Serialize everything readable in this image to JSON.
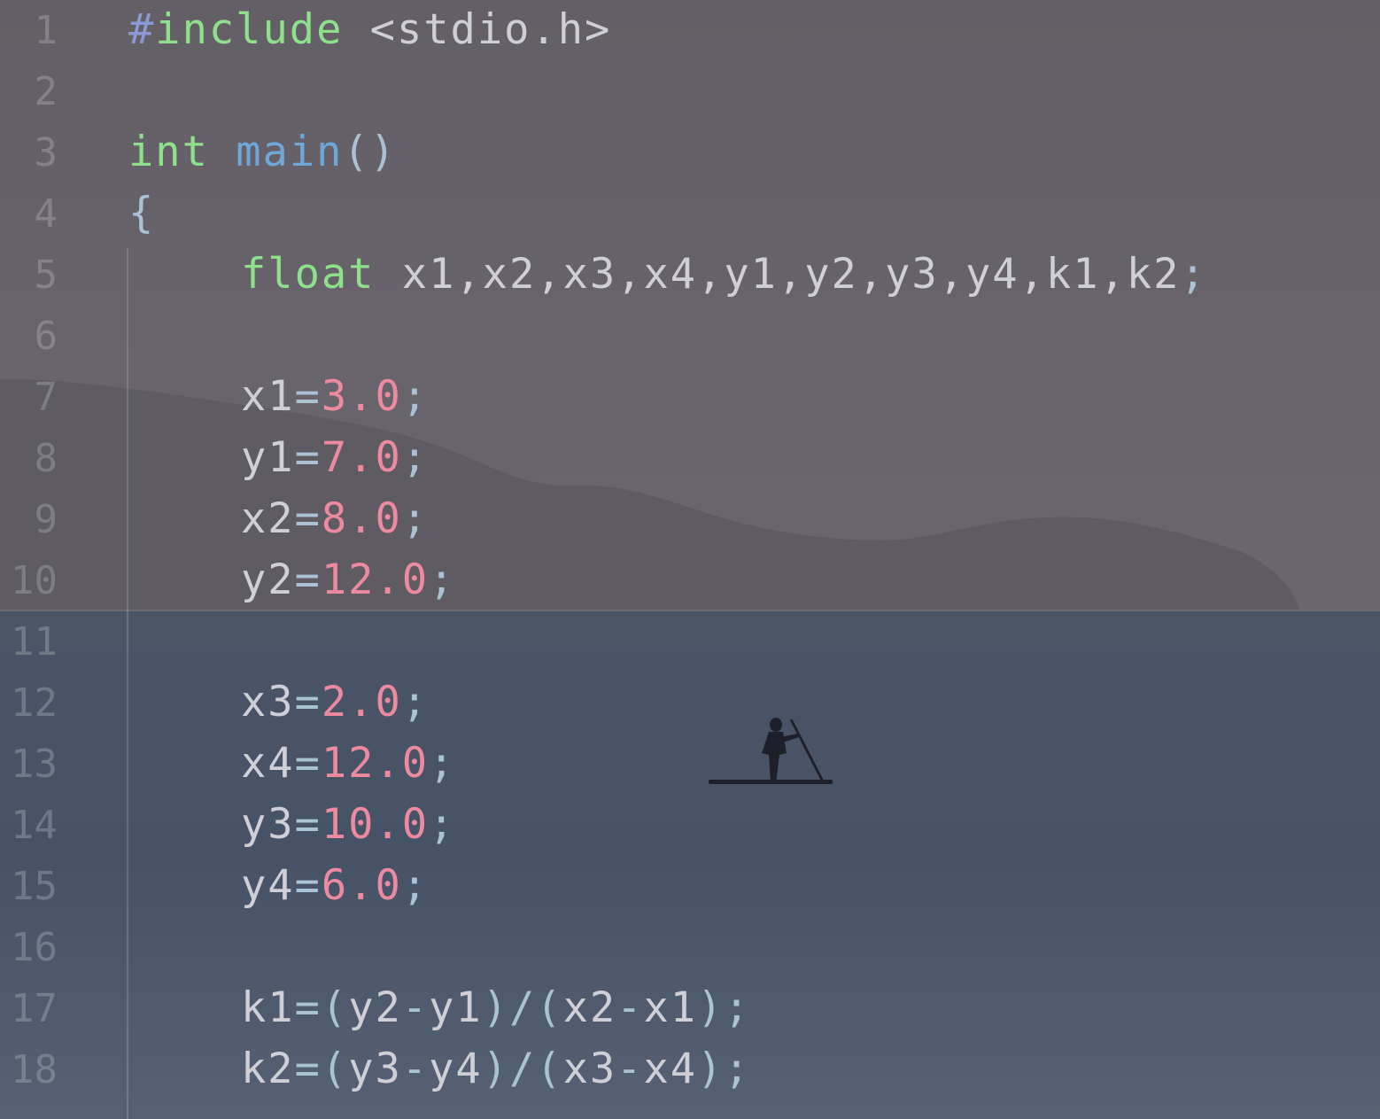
{
  "editor": {
    "lines": [
      {
        "n": "1",
        "tokens": [
          [
            "kw-pre",
            "#"
          ],
          [
            "kw",
            "include"
          ],
          [
            "str",
            " <stdio.h>"
          ]
        ]
      },
      {
        "n": "2",
        "tokens": []
      },
      {
        "n": "3",
        "tokens": [
          [
            "kw",
            "int"
          ],
          [
            "str",
            " "
          ],
          [
            "fn",
            "main"
          ],
          [
            "punc",
            "()"
          ]
        ]
      },
      {
        "n": "4",
        "tokens": [
          [
            "punc",
            "{"
          ]
        ]
      },
      {
        "n": "5",
        "indent": true,
        "tokens": [
          [
            "kw",
            "float"
          ],
          [
            "str",
            " x1,x2,x3,x4,y1,y2,y3,y4,k1,k2"
          ],
          [
            "punc",
            ";"
          ]
        ]
      },
      {
        "n": "6",
        "tokens": []
      },
      {
        "n": "7",
        "indent": true,
        "tokens": [
          [
            "str",
            "x1"
          ],
          [
            "op",
            "="
          ],
          [
            "num",
            "3.0"
          ],
          [
            "punc",
            ";"
          ]
        ]
      },
      {
        "n": "8",
        "indent": true,
        "tokens": [
          [
            "str",
            "y1"
          ],
          [
            "op",
            "="
          ],
          [
            "num",
            "7.0"
          ],
          [
            "punc",
            ";"
          ]
        ]
      },
      {
        "n": "9",
        "indent": true,
        "tokens": [
          [
            "str",
            "x2"
          ],
          [
            "op",
            "="
          ],
          [
            "num",
            "8.0"
          ],
          [
            "punc",
            ";"
          ]
        ]
      },
      {
        "n": "10",
        "indent": true,
        "tokens": [
          [
            "str",
            "y2"
          ],
          [
            "op",
            "="
          ],
          [
            "num",
            "12.0"
          ],
          [
            "punc",
            ";"
          ]
        ]
      },
      {
        "n": "11",
        "tokens": []
      },
      {
        "n": "12",
        "indent": true,
        "tokens": [
          [
            "str",
            "x3"
          ],
          [
            "op",
            "="
          ],
          [
            "num",
            "2.0"
          ],
          [
            "punc",
            ";"
          ]
        ]
      },
      {
        "n": "13",
        "indent": true,
        "tokens": [
          [
            "str",
            "x4"
          ],
          [
            "op",
            "="
          ],
          [
            "num",
            "12.0"
          ],
          [
            "punc",
            ";"
          ]
        ]
      },
      {
        "n": "14",
        "indent": true,
        "tokens": [
          [
            "str",
            "y3"
          ],
          [
            "op",
            "="
          ],
          [
            "num",
            "10.0"
          ],
          [
            "punc",
            ";"
          ]
        ]
      },
      {
        "n": "15",
        "indent": true,
        "tokens": [
          [
            "str",
            "y4"
          ],
          [
            "op",
            "="
          ],
          [
            "num",
            "6.0"
          ],
          [
            "punc",
            ";"
          ]
        ]
      },
      {
        "n": "16",
        "tokens": []
      },
      {
        "n": "17",
        "indent": true,
        "tokens": [
          [
            "str",
            "k1"
          ],
          [
            "op",
            "=("
          ],
          [
            "str",
            "y2"
          ],
          [
            "op",
            "-"
          ],
          [
            "str",
            "y1"
          ],
          [
            "op",
            ")/("
          ],
          [
            "str",
            "x2"
          ],
          [
            "op",
            "-"
          ],
          [
            "str",
            "x1"
          ],
          [
            "op",
            ");"
          ]
        ]
      },
      {
        "n": "18",
        "indent": true,
        "tokens": [
          [
            "str",
            "k2"
          ],
          [
            "op",
            "=("
          ],
          [
            "str",
            "y3"
          ],
          [
            "op",
            "-"
          ],
          [
            "str",
            "y4"
          ],
          [
            "op",
            ")/("
          ],
          [
            "str",
            "x3"
          ],
          [
            "op",
            "-"
          ],
          [
            "str",
            "x4"
          ],
          [
            "op",
            ");"
          ]
        ]
      }
    ]
  },
  "colors": {
    "keyword": "#8ee08a",
    "preprocessor": "#8a9ad6",
    "function": "#6fa8d8",
    "number": "#ee8aa0",
    "punctuation": "#a9c3d4",
    "text": "#e8e8ec"
  }
}
